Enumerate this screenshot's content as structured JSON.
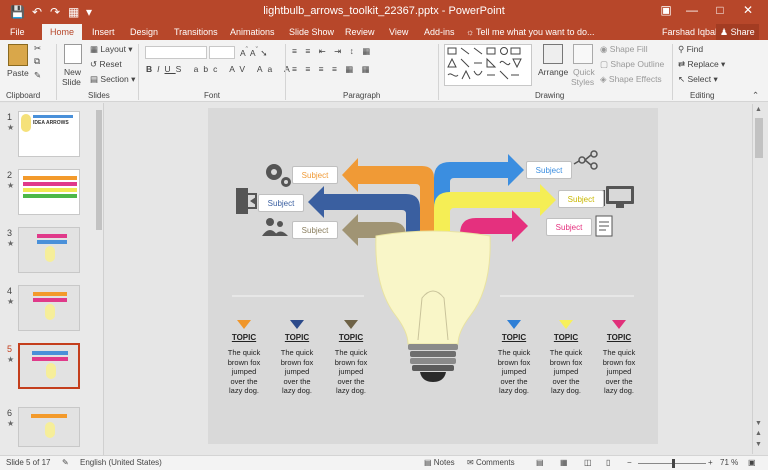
{
  "titlebar": {
    "title": "lightbulb_arrows_toolkit_22367.pptx - PowerPoint"
  },
  "tabs": [
    {
      "label": "File"
    },
    {
      "label": "Home"
    },
    {
      "label": "Insert"
    },
    {
      "label": "Design"
    },
    {
      "label": "Transitions"
    },
    {
      "label": "Animations"
    },
    {
      "label": "Slide Show"
    },
    {
      "label": "Review"
    },
    {
      "label": "View"
    },
    {
      "label": "Add-ins"
    },
    {
      "label": "Tell me what you want to do..."
    },
    {
      "label": "Farshad Iqbal"
    },
    {
      "label": "Share"
    }
  ],
  "ribbon": {
    "clipboard": {
      "paste": "Paste",
      "label": "Clipboard"
    },
    "slides": {
      "new_slide": "New",
      "new_slide2": "Slide",
      "layout": "Layout",
      "reset": "Reset",
      "section": "Section",
      "label": "Slides"
    },
    "font": {
      "label": "Font"
    },
    "paragraph": {
      "label": "Paragraph"
    },
    "drawing": {
      "arrange": "Arrange",
      "quick": "Quick",
      "styles": "Styles",
      "fill": "Shape Fill",
      "outline": "Shape Outline",
      "effects": "Shape Effects",
      "label": "Drawing"
    },
    "editing": {
      "find": "Find",
      "replace": "Replace",
      "select": "Select",
      "label": "Editing"
    }
  },
  "thumbnails": [
    {
      "num": "1",
      "title": "IDEA ARROWS"
    },
    {
      "num": "2"
    },
    {
      "num": "3"
    },
    {
      "num": "4"
    },
    {
      "num": "5"
    },
    {
      "num": "6"
    }
  ],
  "slide": {
    "subjects_left": [
      "Subject",
      "Subject",
      "Subject"
    ],
    "subjects_right": [
      "Subject",
      "Subject",
      "Subject"
    ],
    "topics": [
      {
        "title": "TOPIC",
        "line1": "The quick",
        "line2": "brown fox",
        "line3": "jumped",
        "line4": "over the",
        "line5": "lazy dog.",
        "color": "#f0962a"
      },
      {
        "title": "TOPIC",
        "line1": "The quick",
        "line2": "brown fox",
        "line3": "jumped",
        "line4": "over the",
        "line5": "lazy dog.",
        "color": "#2c4a8a"
      },
      {
        "title": "TOPIC",
        "line1": "The quick",
        "line2": "brown fox",
        "line3": "jumped",
        "line4": "over the",
        "line5": "lazy dog.",
        "color": "#6e6246"
      },
      {
        "title": "TOPIC",
        "line1": "The quick",
        "line2": "brown fox",
        "line3": "jumped",
        "line4": "over the",
        "line5": "lazy dog.",
        "color": "#2e7fd6"
      },
      {
        "title": "TOPIC",
        "line1": "The quick",
        "line2": "brown fox",
        "line3": "jumped",
        "line4": "over the",
        "line5": "lazy dog.",
        "color": "#f7f05a"
      },
      {
        "title": "TOPIC",
        "line1": "The quick",
        "line2": "brown fox",
        "line3": "jumped",
        "line4": "over the",
        "line5": "lazy dog.",
        "color": "#e0307a"
      }
    ]
  },
  "statusbar": {
    "slide_count": "Slide 5 of 17",
    "language": "English (United States)",
    "notes": "Notes",
    "comments": "Comments",
    "zoom": "71 %"
  },
  "colors": {
    "brand": "#b7472a",
    "selected": "#c43e1c"
  }
}
